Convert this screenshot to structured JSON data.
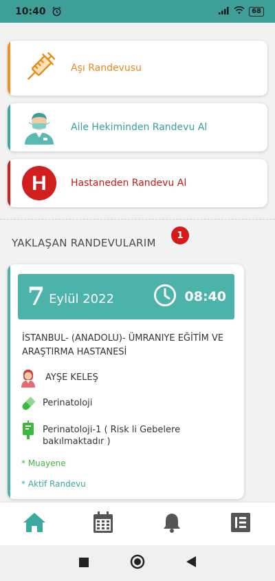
{
  "status_bar": {
    "time": "10:40",
    "battery": "68"
  },
  "menu": [
    {
      "label": "Aşı Randevusu",
      "color": "#f0911c",
      "icon": "syringe-icon"
    },
    {
      "label": "Aile Hekiminden Randevu Al",
      "color": "#3aa99f",
      "icon": "doctor-icon"
    },
    {
      "label": "Hastaneden Randevu Al",
      "color": "#d11f1f",
      "icon": "hospital-icon"
    }
  ],
  "hospital_icon_letter": "H",
  "upcoming": {
    "title": "YAKLAŞAN RANDEVULARIM",
    "count": "1",
    "appointment": {
      "day": "7",
      "month_year": "Eylül 2022",
      "time": "08:40",
      "hospital": "İSTANBUL- (ANADOLU)- ÜMRANIYE EĞİTİM VE ARAŞTIRMA HASTANESİ",
      "doctor": "AYŞE KELEŞ",
      "department": "Perinatoloji",
      "clinic": "Perinatoloji-1 ( Risk li Gebelere bakılmaktadır )",
      "type": "* Muayene",
      "status": "* Aktif Randevu"
    }
  },
  "bottom_nav": [
    "home-icon",
    "calendar-icon",
    "bell-icon",
    "menu-book-icon"
  ],
  "colors": {
    "teal": "#4cb3aa",
    "orange": "#f0911c",
    "red": "#d11f1f",
    "green": "#3cb83c"
  }
}
